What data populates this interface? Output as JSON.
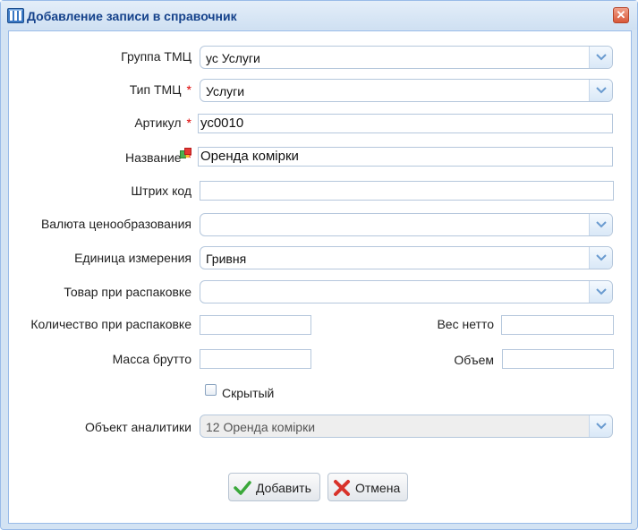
{
  "window": {
    "title": "Добавление записи в справочник",
    "close_label": "✕"
  },
  "form": {
    "group": {
      "label": "Группа ТМЦ",
      "value": "ус Услуги"
    },
    "type": {
      "label": "Тип ТМЦ",
      "value": "Услуги",
      "required": "*"
    },
    "article": {
      "label": "Артикул",
      "value": "ус0010",
      "required": "*"
    },
    "name": {
      "label": "Название",
      "value": "Оренда комірки",
      "required": "*"
    },
    "barcode": {
      "label": "Штрих код",
      "value": ""
    },
    "currency": {
      "label": "Валюта ценообразования",
      "value": ""
    },
    "unit": {
      "label": "Единица измерения",
      "value": "Гривня"
    },
    "unpack_item": {
      "label": "Товар при распаковке",
      "value": ""
    },
    "unpack_qty": {
      "label": "Количество при распаковке",
      "value": ""
    },
    "net_weight": {
      "label": "Вес нетто",
      "value": ""
    },
    "gross_weight": {
      "label": "Масса брутто",
      "value": ""
    },
    "volume": {
      "label": "Объем",
      "value": ""
    },
    "hidden": {
      "label": "Скрытый",
      "checked": false
    },
    "analytics": {
      "label": "Объект аналитики",
      "value": "12 Оренда комірки",
      "disabled": true
    }
  },
  "buttons": {
    "add_label": "Добавить",
    "cancel_label": "Отмена"
  },
  "colors": {
    "title": "#15428b",
    "border": "#99bbe8",
    "required": "#dd0000"
  }
}
